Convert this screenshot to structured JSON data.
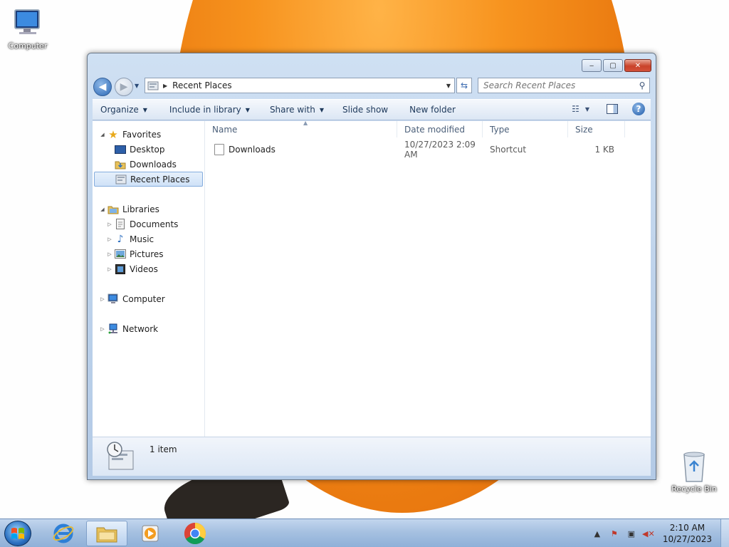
{
  "desktop": {
    "icons": [
      {
        "label": "Computer"
      },
      {
        "label": "Recycle Bin"
      }
    ]
  },
  "window": {
    "caption_buttons": {
      "minimize": "‒",
      "maximize": "▢",
      "close": "✕"
    },
    "address": {
      "location": "Recent Places"
    },
    "search": {
      "placeholder": "Search Recent Places"
    },
    "toolbar": {
      "organize": "Organize",
      "include_in_library": "Include in library",
      "share_with": "Share with",
      "slide_show": "Slide show",
      "new_folder": "New folder"
    },
    "nav_pane": {
      "favorites": "Favorites",
      "desktop": "Desktop",
      "downloads": "Downloads",
      "recent_places": "Recent Places",
      "libraries": "Libraries",
      "documents": "Documents",
      "music": "Music",
      "pictures": "Pictures",
      "videos": "Videos",
      "computer": "Computer",
      "network": "Network"
    },
    "columns": {
      "name": "Name",
      "date_modified": "Date modified",
      "type": "Type",
      "size": "Size"
    },
    "files": [
      {
        "name": "Downloads",
        "date_modified": "10/27/2023 2:09 AM",
        "type": "Shortcut",
        "size": "1 KB"
      }
    ],
    "status": {
      "item_count": "1 item"
    }
  },
  "taskbar": {
    "clock": {
      "time": "2:10 AM",
      "date": "10/27/2023"
    }
  },
  "colors": {
    "accent": "#2c68b5",
    "selection": "#cfe2f8",
    "orange": "#f7931e"
  }
}
